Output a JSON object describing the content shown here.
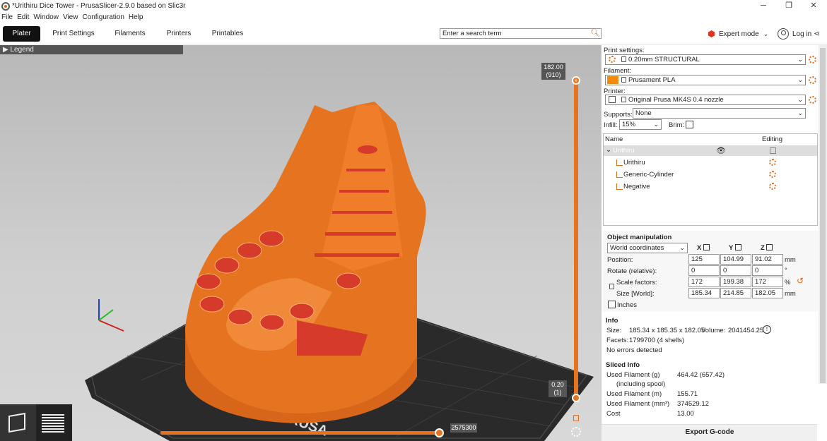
{
  "window": {
    "title": "*Urithiru Dice Tower - PrusaSlicer-2.9.0 based on Slic3r",
    "minimize": "─",
    "maximize": "❐",
    "close": "✕"
  },
  "menu": [
    "File",
    "Edit",
    "Window",
    "View",
    "Configuration",
    "Help"
  ],
  "tabs": [
    "Plater",
    "Print Settings",
    "Filaments",
    "Printers",
    "Printables"
  ],
  "search": {
    "placeholder": "Enter a search term"
  },
  "mode": {
    "label": "Expert mode",
    "color": "#e3341f"
  },
  "login": {
    "label": "Log in"
  },
  "legend": {
    "label": "Legend"
  },
  "layer_slider": {
    "top_value": "182.00",
    "top_layer": "(910)",
    "bottom_value": "0.20",
    "bottom_layer": "(1)",
    "top_fraction": 1.0,
    "bottom_fraction": 0.0
  },
  "horizontal_slider": {
    "value": "2575300",
    "fraction": 1.0
  },
  "sidebar": {
    "print_settings": {
      "label": "Print settings:",
      "value": "0.20mm STRUCTURAL"
    },
    "filament": {
      "label": "Filament:",
      "value": "Prusament PLA",
      "color": "#f28a0c"
    },
    "printer": {
      "label": "Printer:",
      "value": "Original Prusa MK4S 0.4 nozzle"
    },
    "supports": {
      "label": "Supports:",
      "value": "None"
    },
    "infill": {
      "label": "Infill:",
      "value": "15%"
    },
    "brim": {
      "label": "Brim:"
    },
    "tree": {
      "col_name": "Name",
      "col_editing": "Editing",
      "object": "Urithiru",
      "parts": [
        "Urithiru",
        "Generic-Cylinder",
        "Negative"
      ]
    },
    "object_manipulation": {
      "title": "Object manipulation",
      "coords": "World coordinates",
      "axes": [
        "X",
        "Y",
        "Z"
      ],
      "rows": [
        {
          "label": "Position:",
          "values": [
            "125",
            "104.99",
            "91.02"
          ],
          "unit": "mm"
        },
        {
          "label": "Rotate (relative):",
          "values": [
            "0",
            "0",
            "0"
          ],
          "unit": "°"
        },
        {
          "label": "Scale factors:",
          "values": [
            "172",
            "199.38",
            "172"
          ],
          "unit": "%"
        },
        {
          "label": "Size [World]:",
          "values": [
            "185.34",
            "214.85",
            "182.05"
          ],
          "unit": "mm"
        }
      ],
      "inches": "Inches"
    },
    "info": {
      "title": "Info",
      "size_label": "Size:",
      "size": "185.34 x 185.35 x 182.05",
      "volume_label": "Volume:",
      "volume": "2041454.25",
      "facets_label": "Facets:",
      "facets": "1799700 (4 shells)",
      "errors": "No errors detected"
    },
    "sliced": {
      "title": "Sliced Info",
      "rows": [
        {
          "label": "Used Filament (g)",
          "value": "464.42 (657.42)"
        },
        {
          "label": "(including spool)",
          "value": ""
        },
        {
          "label": "Used Filament (m)",
          "value": "155.71"
        },
        {
          "label": "Used Filament (mm³)",
          "value": "374529.12"
        },
        {
          "label": "Cost",
          "value": "13.00"
        }
      ]
    },
    "export": "Export G-code"
  },
  "bed": {
    "brand": "PRUSA"
  }
}
